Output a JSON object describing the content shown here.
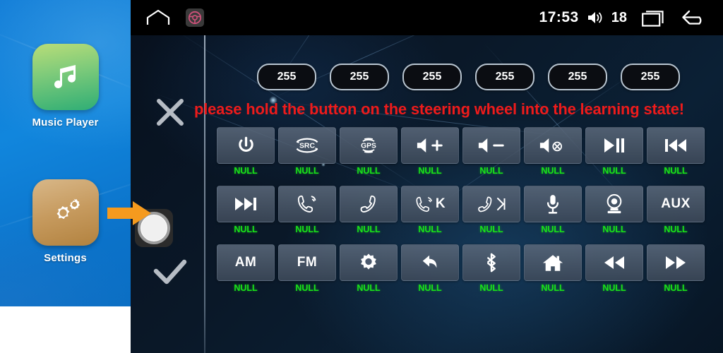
{
  "sidebar": {
    "apps": [
      {
        "label": "Music Player",
        "icon": "music-note-icon"
      },
      {
        "label": "Settings",
        "icon": "gears-icon"
      }
    ],
    "pointer_icon": "orange-arrow-pointer-icon",
    "background_color": "#0d7ad6"
  },
  "statusbar": {
    "home_icon": "home-outline-icon",
    "steering_wheel_icon": "steering-wheel-icon",
    "time": "17:53",
    "volume_icon": "volume-speaker-icon",
    "volume_level": "18",
    "recents_icon": "recent-apps-icon",
    "back_icon": "back-arrow-icon"
  },
  "tools": {
    "close_icon": "close-x-icon",
    "confirm_icon": "checkmark-icon",
    "record_icon": "record-circle-button-icon"
  },
  "values": {
    "pills": [
      "255",
      "255",
      "255",
      "255",
      "255",
      "255"
    ]
  },
  "warning": {
    "text": "please hold the button on the steering wheel into the learning state!",
    "color": "#ee1b1b"
  },
  "grid": {
    "null_label": "NULL",
    "label_color": "#19e219",
    "rows": [
      [
        {
          "name": "power",
          "icon": "power-icon",
          "text": "",
          "label": "NULL"
        },
        {
          "name": "source",
          "icon": "src-icon",
          "text": "SRC",
          "label": "NULL"
        },
        {
          "name": "gps",
          "icon": "gps-icon",
          "text": "GPS",
          "label": "NULL"
        },
        {
          "name": "volume-up",
          "icon": "volume-up-icon",
          "text": "",
          "label": "NULL"
        },
        {
          "name": "volume-down",
          "icon": "volume-down-icon",
          "text": "",
          "label": "NULL"
        },
        {
          "name": "mute",
          "icon": "volume-mute-icon",
          "text": "",
          "label": "NULL"
        },
        {
          "name": "play-pause",
          "icon": "play-pause-icon",
          "text": "",
          "label": "NULL"
        },
        {
          "name": "previous-track",
          "icon": "previous-track-icon",
          "text": "",
          "label": "NULL"
        }
      ],
      [
        {
          "name": "next-track",
          "icon": "next-track-icon",
          "text": "",
          "label": "NULL"
        },
        {
          "name": "answer-call",
          "icon": "phone-answer-icon",
          "text": "",
          "label": "NULL"
        },
        {
          "name": "end-call",
          "icon": "phone-hangup-icon",
          "text": "",
          "label": "NULL"
        },
        {
          "name": "answer-call-k",
          "icon": "phone-answer-k-icon",
          "text": "K",
          "label": "NULL"
        },
        {
          "name": "end-call-next",
          "icon": "phone-hangup-next-icon",
          "text": "",
          "label": "NULL"
        },
        {
          "name": "microphone",
          "icon": "microphone-icon",
          "text": "",
          "label": "NULL"
        },
        {
          "name": "camera",
          "icon": "camera-icon",
          "text": "",
          "label": "NULL"
        },
        {
          "name": "aux",
          "icon": "aux-icon",
          "text": "AUX",
          "label": "NULL"
        }
      ],
      [
        {
          "name": "am-band",
          "icon": "am-icon",
          "text": "AM",
          "label": "NULL"
        },
        {
          "name": "fm-band",
          "icon": "fm-icon",
          "text": "FM",
          "label": "NULL"
        },
        {
          "name": "settings",
          "icon": "gear-icon",
          "text": "",
          "label": "NULL"
        },
        {
          "name": "back",
          "icon": "back-curved-arrow-icon",
          "text": "",
          "label": "NULL"
        },
        {
          "name": "bluetooth",
          "icon": "bluetooth-icon",
          "text": "",
          "label": "NULL"
        },
        {
          "name": "home",
          "icon": "home-filled-icon",
          "text": "",
          "label": "NULL"
        },
        {
          "name": "rewind",
          "icon": "rewind-icon",
          "text": "",
          "label": "NULL"
        },
        {
          "name": "fast-forward",
          "icon": "fast-forward-icon",
          "text": "",
          "label": "NULL"
        }
      ]
    ]
  }
}
